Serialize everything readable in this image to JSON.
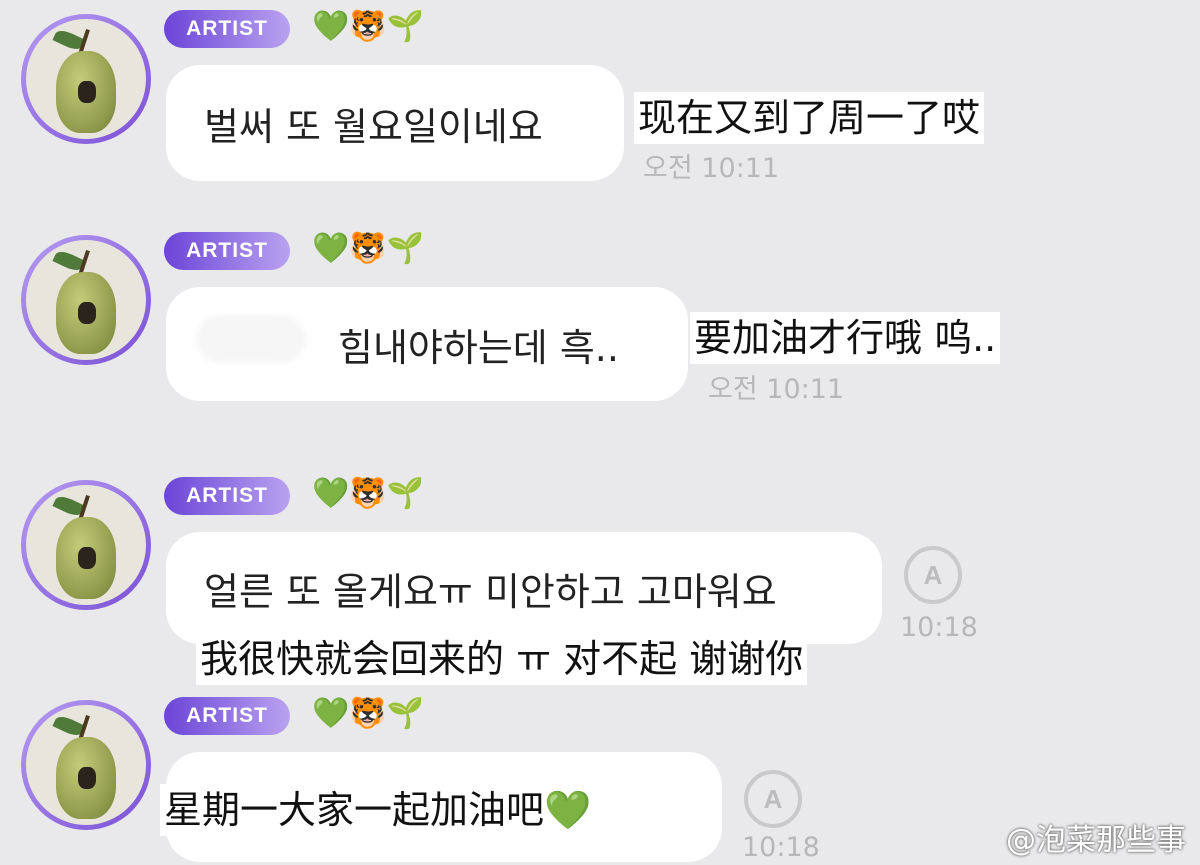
{
  "messages": [
    {
      "badge": "ARTIST",
      "emojis": [
        "💚",
        "🐯",
        "🌱"
      ],
      "text": "벌써 또 월요일이네요",
      "time": "오전 10:11",
      "translation": "现在又到了周一了哎"
    },
    {
      "badge": "ARTIST",
      "emojis": [
        "💚",
        "🐯",
        "🌱"
      ],
      "text": "힘내야하는데 흑..",
      "time": "오전 10:11",
      "translation": "要加油才行哦 呜.."
    },
    {
      "badge": "ARTIST",
      "emojis": [
        "💚",
        "🐯",
        "🌱"
      ],
      "text": "얼른 또 올게요ㅠ 미안하고 고마워요",
      "time": "10:18",
      "translate_icon": "A",
      "translation": "我很快就会回来的 ㅠ 对不起 谢谢你"
    },
    {
      "badge": "ARTIST",
      "emojis": [
        "💚",
        "🐯",
        "🌱"
      ],
      "text": "",
      "time": "10:18",
      "translate_icon": "A",
      "translation": "星期一大家一起加油吧💚"
    }
  ],
  "watermark": "@泡菜那些事"
}
